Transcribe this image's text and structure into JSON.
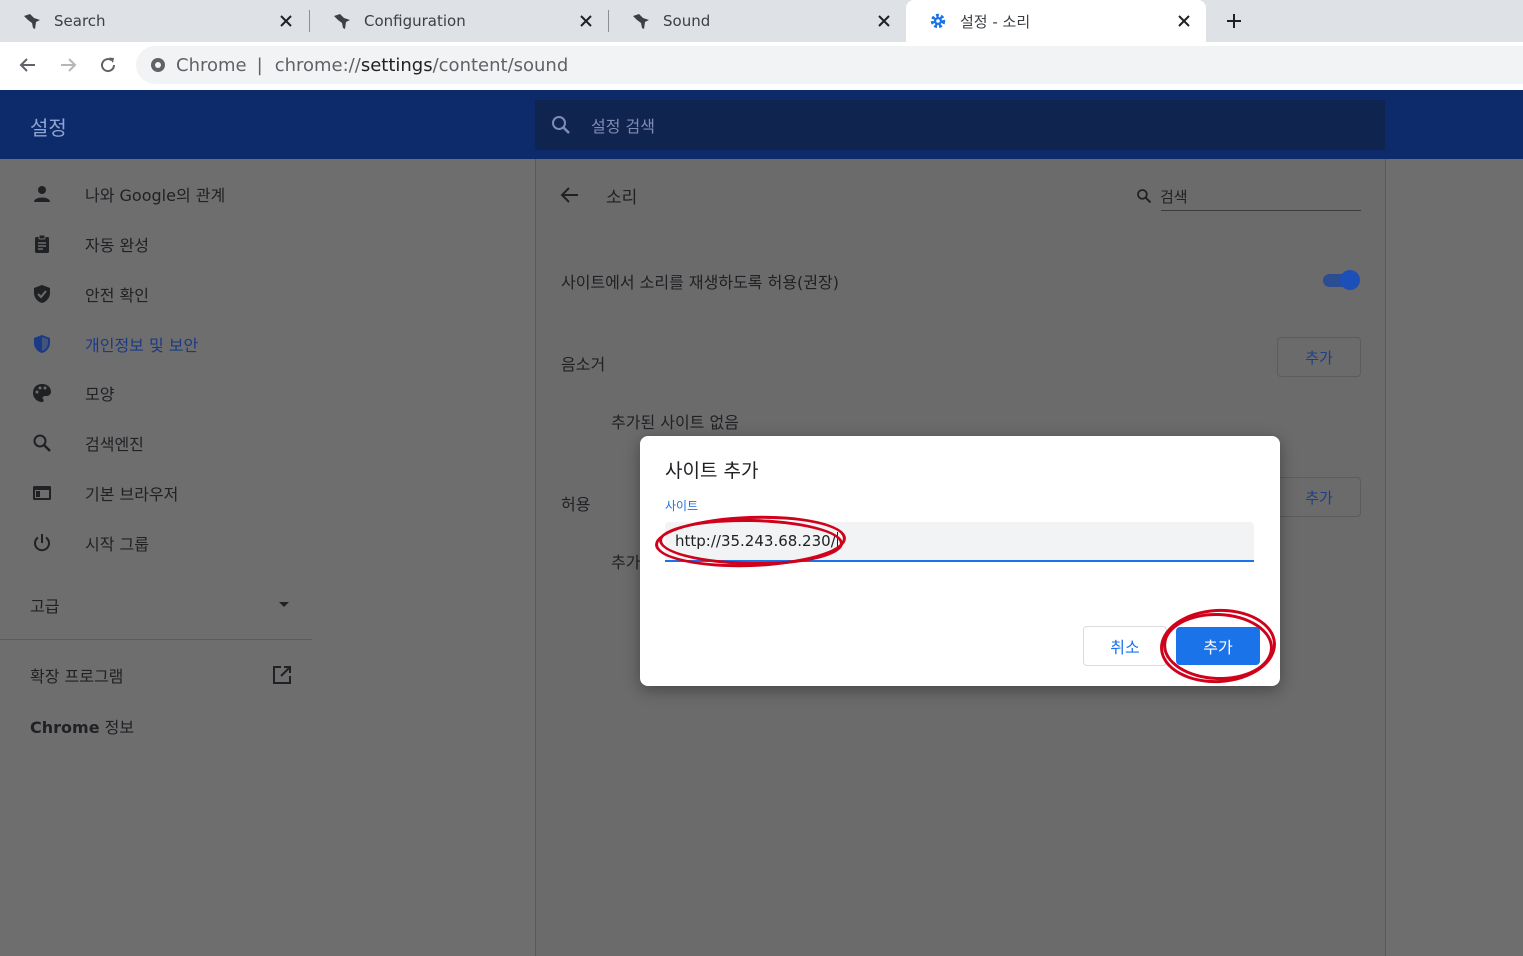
{
  "browser": {
    "tabs": [
      {
        "title": "Search",
        "favicon": "bird-icon"
      },
      {
        "title": "Configuration",
        "favicon": "bird-icon"
      },
      {
        "title": "Sound",
        "favicon": "bird-icon"
      },
      {
        "title": "설정 - 소리",
        "favicon": "gear-icon",
        "active": true
      }
    ],
    "omnibox": {
      "site_label": "Chrome",
      "separator": "|",
      "url_prefix": "chrome://",
      "url_host": "settings",
      "url_path": "/content/sound"
    }
  },
  "settings": {
    "title": "설정",
    "search_placeholder": "설정 검색"
  },
  "sidebar": {
    "items": [
      {
        "label": "나와 Google의 관계",
        "icon": "person-icon"
      },
      {
        "label": "자동 완성",
        "icon": "clipboard-icon"
      },
      {
        "label": "안전 확인",
        "icon": "shield-check-icon"
      },
      {
        "label": "개인정보 및 보안",
        "icon": "shield-icon",
        "selected": true
      },
      {
        "label": "모양",
        "icon": "palette-icon"
      },
      {
        "label": "검색엔진",
        "icon": "search-icon"
      },
      {
        "label": "기본 브라우저",
        "icon": "browser-icon"
      },
      {
        "label": "시작 그룹",
        "icon": "power-icon"
      }
    ],
    "advanced": "고급",
    "extensions": "확장 프로그램",
    "about_bold": "Chrome",
    "about_rest": " 정보"
  },
  "page": {
    "title": "소리",
    "search_value": "검색",
    "allow_sound_label": "사이트에서 소리를 재생하도록 허용(권장)",
    "allow_sound_enabled": true,
    "mute_section": "음소거",
    "add_label": "추가",
    "no_sites": "추가된 사이트 없음",
    "allow_section": "허용",
    "allow_list_partial": "추가"
  },
  "dialog": {
    "title": "사이트 추가",
    "field_label": "사이트",
    "field_value": "http://35.243.68.230/",
    "cancel": "취소",
    "confirm": "추가"
  },
  "colors": {
    "accent": "#1a73e8",
    "annotation": "#d0021b"
  }
}
